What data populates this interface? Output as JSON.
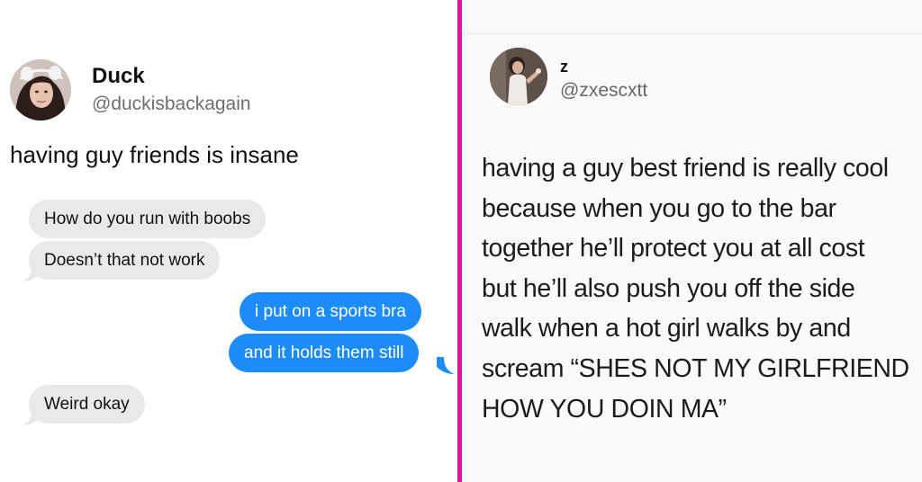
{
  "left_tweet": {
    "display_name": "Duck",
    "handle": "@duckisbackagain",
    "text": "having guy friends is insane",
    "messages": [
      {
        "direction": "incoming",
        "text": "How do you run with boobs"
      },
      {
        "direction": "incoming",
        "text": "Doesn’t that not work"
      },
      {
        "direction": "outgoing",
        "text": "i put on a sports bra"
      },
      {
        "direction": "outgoing",
        "text": "and it holds them still"
      },
      {
        "direction": "incoming",
        "text": "Weird okay"
      }
    ]
  },
  "right_tweet": {
    "display_name": "z",
    "handle": "@zxescxtt",
    "lines": [
      "having a guy best friend is really cool",
      "because when you go to the bar",
      "together he’ll protect you at all cost",
      "but he’ll also push you off the side",
      "walk when a hot girl walks by and",
      "scream “SHES NOT MY GIRLFRIEND",
      "HOW YOU DOIN MA”"
    ]
  },
  "colors": {
    "divider": "#e0139e",
    "incoming_bubble": "#e9e9eb",
    "outgoing_bubble": "#1e8cf8",
    "handle_gray": "#6b6f74"
  }
}
